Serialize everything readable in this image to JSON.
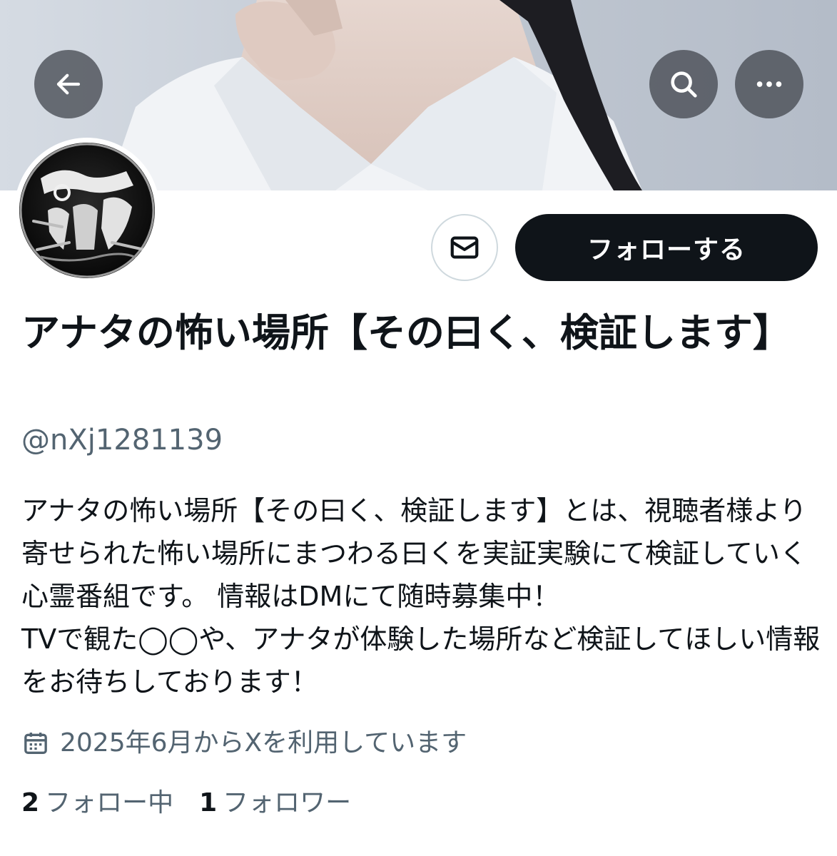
{
  "header": {
    "back_icon": "arrow-left-icon",
    "search_icon": "search-icon",
    "more_icon": "more-horizontal-icon"
  },
  "profile": {
    "avatar_icon": "channel-logo-avatar",
    "display_name": "アナタの怖い場所【その曰く、検証します】",
    "handle": "@nXj1281139",
    "bio": "アナタの怖い場所【その曰く、検証します】とは、視聴者様より寄せられた怖い場所にまつわる曰くを実証実験にて検証していく心霊番組です。 情報はDMにて随時募集中！\nTVで観た◯◯や、アナタが体験した場所など検証してほしい情報をお待ちしております！",
    "joined": "2025年6月からXを利用しています",
    "joined_icon": "calendar-icon"
  },
  "actions": {
    "dm_icon": "envelope-icon",
    "follow_label": "フォローする"
  },
  "stats": {
    "following_count": "2",
    "following_label": "フォロー中",
    "followers_count": "1",
    "followers_label": "フォロワー"
  },
  "colors": {
    "text_primary": "#0f1419",
    "text_secondary": "#536471",
    "border": "#cfd9de",
    "button_dark": "#0f1419"
  }
}
